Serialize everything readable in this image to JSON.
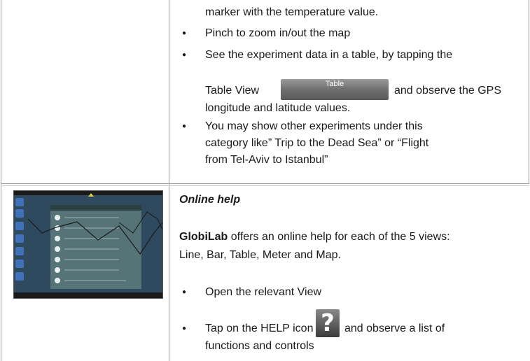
{
  "top_cell": {
    "line1": "marker with the temperature value.",
    "bullets": [
      {
        "text": "Pinch to zoom in/out the map"
      },
      {
        "text": "See the experiment data in a table, by tapping the"
      },
      {
        "text": "You may show other experiments under this"
      }
    ],
    "table_pre": "Table View",
    "table_btn_label": "Table",
    "table_post": "and observe the GPS",
    "table_line3": "longitude and latitude values.",
    "exp_line2": "category like” Trip to the Dead Sea” or “Flight",
    "exp_line3": "from Tel-Aviv to Istanbul”"
  },
  "bottom_cell": {
    "heading": "Online help",
    "brand": "GlobiLab",
    "para1_rest": " offers an online help for each of the 5 views:",
    "para2": "Line, Bar, Table, Meter and Map.",
    "bullet1": "Open the relevant View",
    "bullet2_pre": "Tap on the HELP icon",
    "bullet2_post": "and observe a list of",
    "bullet2_line2": "functions and controls",
    "help_icon_glyph": "?"
  },
  "colors": {
    "screenshot_bg": "#2f4a5e",
    "help_panel": "#5d7a7c",
    "sidebar_icon": "#3f72b8"
  },
  "icons": [
    "table-view-button",
    "help-icon",
    "globilab-screenshot"
  ]
}
